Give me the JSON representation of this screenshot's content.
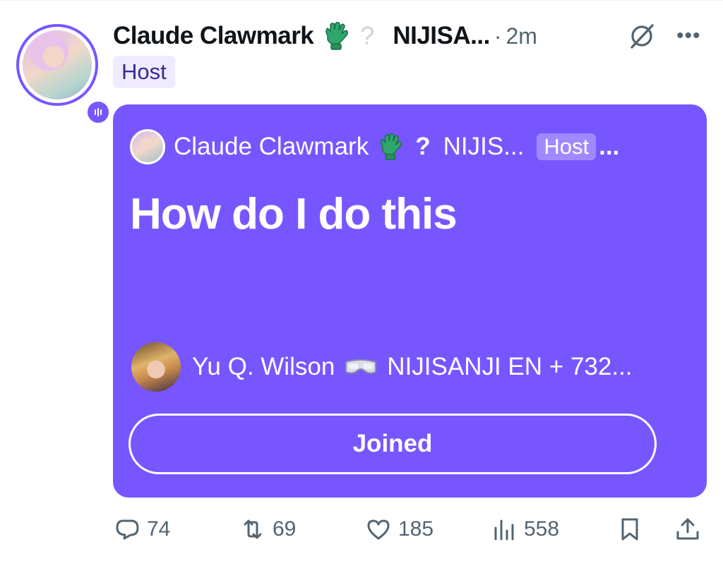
{
  "post": {
    "author_name": "Claude Clawmark",
    "author_emoji": "gloves-emoji",
    "author_flag": "?",
    "handle": "NIJISA...",
    "separator": "·",
    "time": "2m",
    "role_tag": "Host"
  },
  "space_card": {
    "background": "#7856ff",
    "host_name": "Claude Clawmark",
    "host_flag": "?",
    "host_handle": "NIJIS...",
    "host_tag": "Host",
    "ellipsis": "...",
    "title": "How do I do this",
    "listener_name": "Yu Q. Wilson",
    "listener_suffix": "NIJISANJI EN + 732...",
    "join_label": "Joined"
  },
  "actions": {
    "replies": "74",
    "reposts": "69",
    "likes": "185",
    "views": "558"
  },
  "icons": {
    "reply": "reply-icon",
    "repost": "repost-icon",
    "like": "heart-icon",
    "views": "views-icon",
    "bookmark": "bookmark-icon",
    "share": "share-icon",
    "grok": "grok-icon",
    "more": "more-icon"
  }
}
